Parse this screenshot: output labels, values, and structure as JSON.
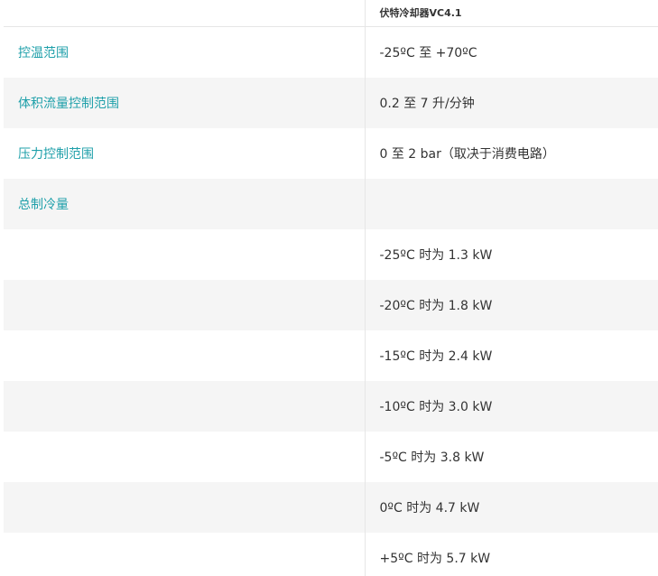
{
  "table": {
    "header": {
      "label": "",
      "value": "伏特冷却器VC4.1"
    },
    "rows": [
      {
        "label": "控温范围",
        "value": "-25ºC 至 +70ºC"
      },
      {
        "label": "体积流量控制范围",
        "value": "0.2 至 7 升/分钟"
      },
      {
        "label": "压力控制范围",
        "value": "0 至 2 bar（取决于消费电路）"
      },
      {
        "label": "总制冷量",
        "value": ""
      },
      {
        "label": "",
        "value": "-25ºC 时为 1.3 kW"
      },
      {
        "label": "",
        "value": "-20ºC 时为 1.8 kW"
      },
      {
        "label": "",
        "value": "-15ºC 时为 2.4 kW"
      },
      {
        "label": "",
        "value": "-10ºC 时为 3.0 kW"
      },
      {
        "label": "",
        "value": "-5ºC 时为 3.8 kW"
      },
      {
        "label": "",
        "value": "0ºC 时为 4.7 kW"
      },
      {
        "label": "",
        "value": "+5ºC 时为 5.7 kW"
      }
    ]
  },
  "colors": {
    "label_text": "#1fa0aa",
    "value_text": "#333333",
    "stripe_background": "#f5f5f5",
    "border": "#e6e6e6"
  }
}
